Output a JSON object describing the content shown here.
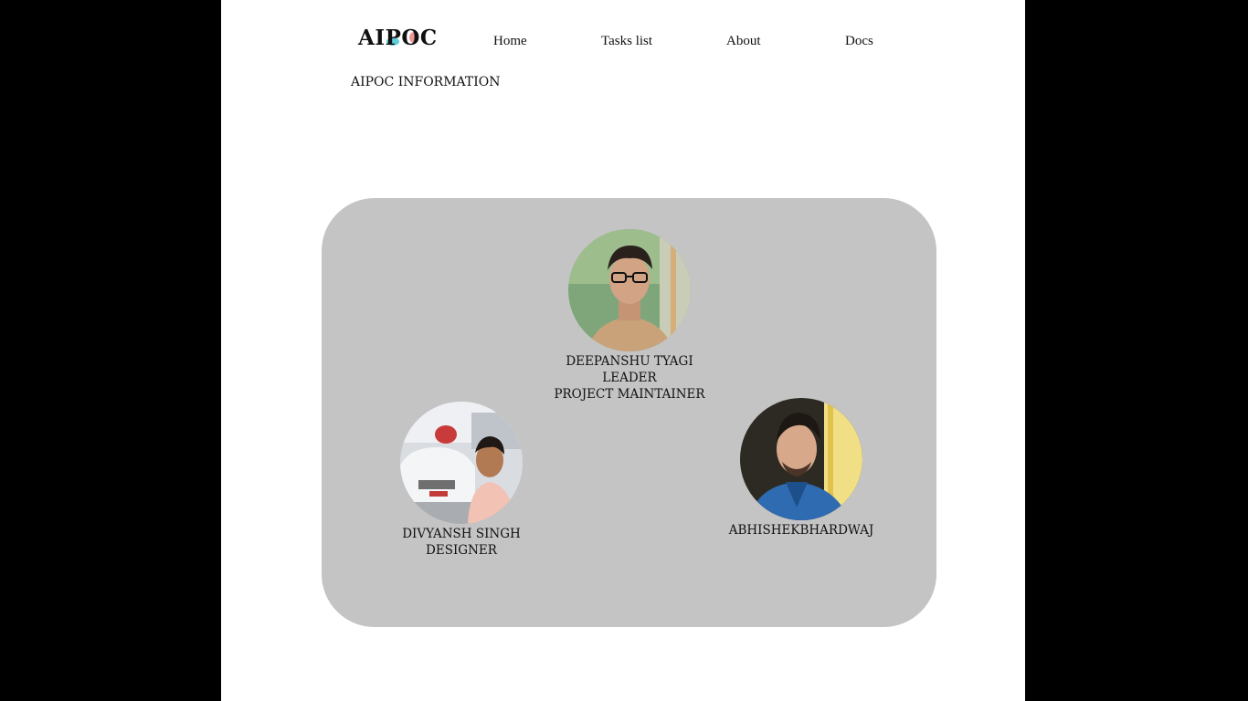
{
  "brand": {
    "name": "AIPOC"
  },
  "nav": {
    "items": [
      {
        "label": "Home"
      },
      {
        "label": "Tasks list"
      },
      {
        "label": "About"
      },
      {
        "label": "Docs"
      }
    ]
  },
  "section": {
    "title": "AIPOC INFORMATION"
  },
  "members": [
    {
      "name": "DEEPANSHU TYAGI",
      "role": "LEADER",
      "extra": "PROJECT MAINTAINER"
    },
    {
      "name": "DIVYANSH SINGH",
      "role": "DESIGNER"
    },
    {
      "name": "ABHISHEKBHARDWAJ"
    }
  ],
  "colors": {
    "card": "#c4c4c4",
    "background": "#000000",
    "page": "#ffffff",
    "logo_accent": "#3fc6d6"
  }
}
